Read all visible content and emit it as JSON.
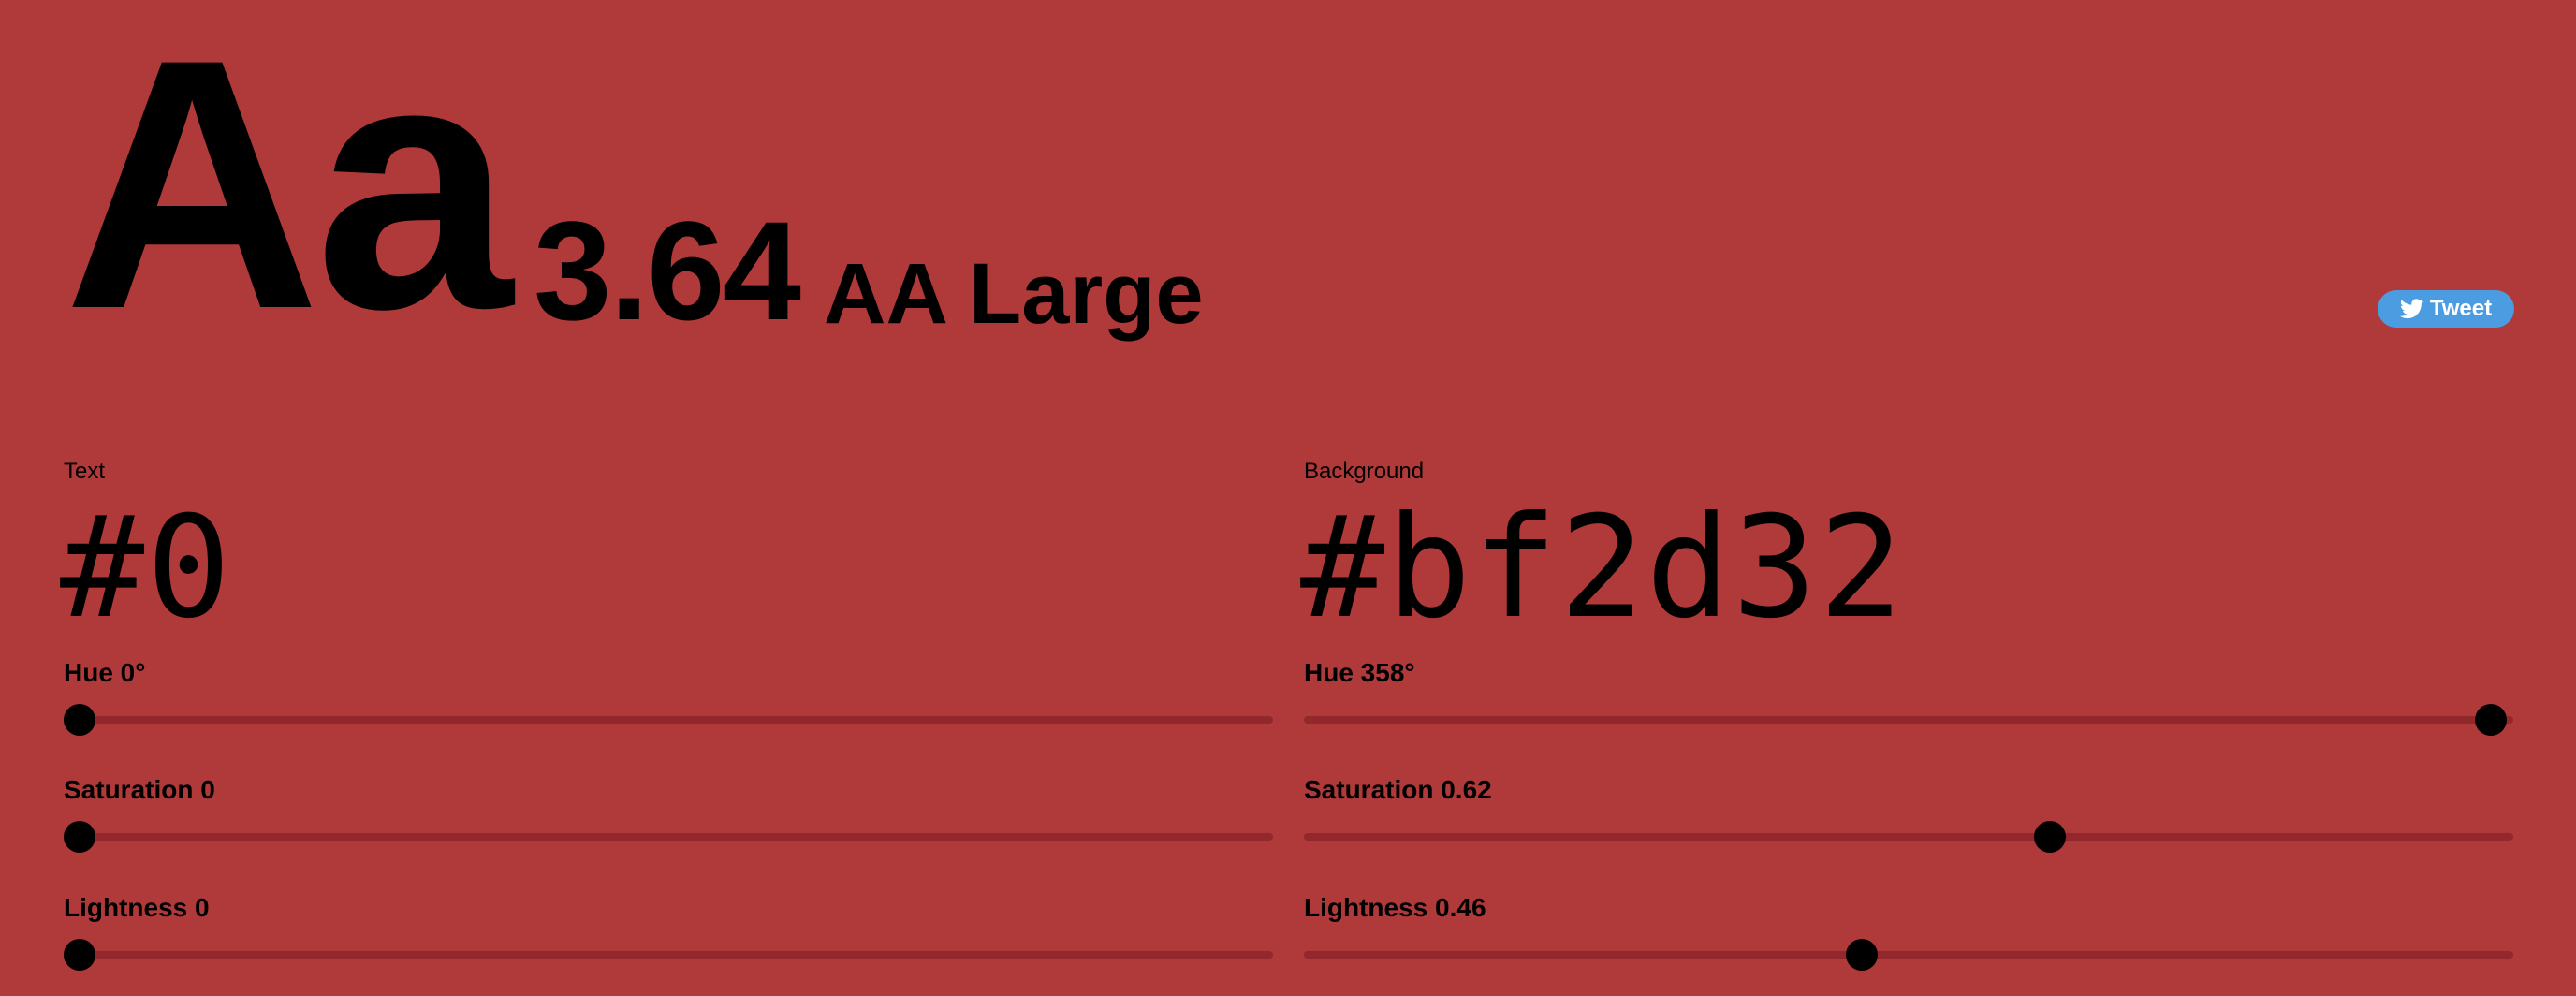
{
  "colors": {
    "text": "#000000",
    "background": "#b03939",
    "slider_track": "#92272c",
    "tweet_button": "#4b9ce1"
  },
  "sample_text": "Aa",
  "contrast": {
    "ratio": "3.64",
    "rating": "AA Large"
  },
  "tweet": {
    "label": "Tweet",
    "icon": "twitter-bird-icon"
  },
  "text_panel": {
    "label": "Text",
    "hex": "#0",
    "sliders": [
      {
        "name": "hue",
        "label": "Hue 0°",
        "value": 0,
        "min": 0,
        "max": 360
      },
      {
        "name": "saturation",
        "label": "Saturation 0",
        "value": 0,
        "min": 0,
        "max": 1
      },
      {
        "name": "lightness",
        "label": "Lightness 0",
        "value": 0,
        "min": 0,
        "max": 1
      }
    ]
  },
  "background_panel": {
    "label": "Background",
    "hex": "#bf2d32",
    "sliders": [
      {
        "name": "hue",
        "label": "Hue 358°",
        "value": 358,
        "min": 0,
        "max": 360
      },
      {
        "name": "saturation",
        "label": "Saturation 0.62",
        "value": 0.62,
        "min": 0,
        "max": 1
      },
      {
        "name": "lightness",
        "label": "Lightness 0.46",
        "value": 0.46,
        "min": 0,
        "max": 1
      }
    ]
  }
}
